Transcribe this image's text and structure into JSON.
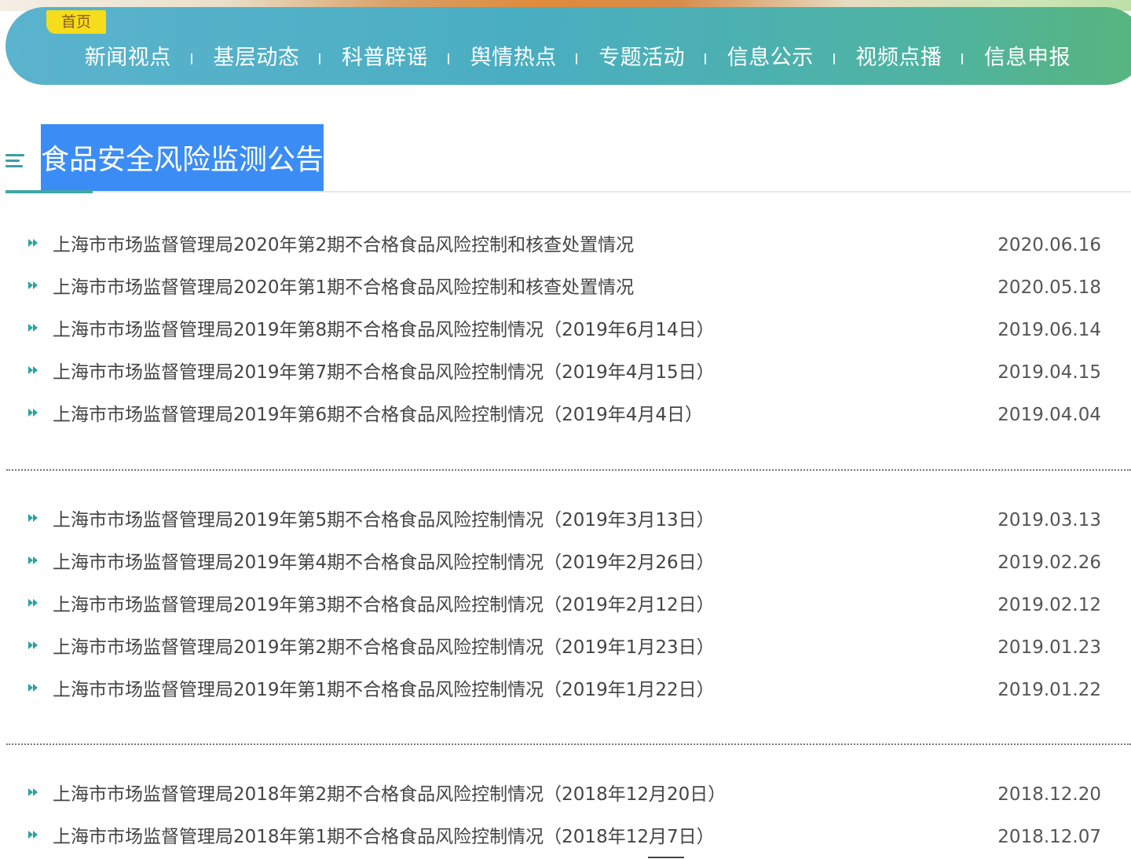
{
  "nav": {
    "home_tab": "首页",
    "items": [
      "新闻视点",
      "基层动态",
      "科普辟谣",
      "舆情热点",
      "专题活动",
      "信息公示",
      "视频点播",
      "信息申报"
    ]
  },
  "section": {
    "title": "食品安全风险监测公告"
  },
  "groups": [
    {
      "items": [
        {
          "title": "上海市市场监督管理局2020年第2期不合格食品风险控制和核查处置情况",
          "date": "2020.06.16"
        },
        {
          "title": "上海市市场监督管理局2020年第1期不合格食品风险控制和核查处置情况",
          "date": "2020.05.18"
        },
        {
          "title": "上海市市场监督管理局2019年第8期不合格食品风险控制情况（2019年6月14日）",
          "date": "2019.06.14"
        },
        {
          "title": "上海市市场监督管理局2019年第7期不合格食品风险控制情况（2019年4月15日）",
          "date": "2019.04.15"
        },
        {
          "title": "上海市市场监督管理局2019年第6期不合格食品风险控制情况（2019年4月4日）",
          "date": "2019.04.04"
        }
      ]
    },
    {
      "items": [
        {
          "title": "上海市市场监督管理局2019年第5期不合格食品风险控制情况（2019年3月13日）",
          "date": "2019.03.13"
        },
        {
          "title": "上海市市场监督管理局2019年第4期不合格食品风险控制情况（2019年2月26日）",
          "date": "2019.02.26"
        },
        {
          "title": "上海市市场监督管理局2019年第3期不合格食品风险控制情况（2019年2月12日）",
          "date": "2019.02.12"
        },
        {
          "title": "上海市市场监督管理局2019年第2期不合格食品风险控制情况（2019年1月23日）",
          "date": "2019.01.23"
        },
        {
          "title": "上海市市场监督管理局2019年第1期不合格食品风险控制情况（2019年1月22日）",
          "date": "2019.01.22"
        }
      ]
    },
    {
      "items": [
        {
          "title": "上海市市场监督管理局2018年第2期不合格食品风险控制情况（2018年12月20日）",
          "date": "2018.12.20"
        },
        {
          "title": "上海市市场监督管理局2018年第1期不合格食品风险控制情况（2018年12月7日）",
          "date": "2018.12.07"
        }
      ]
    }
  ],
  "colors": {
    "accent": "#3b8df5",
    "bullet": "#2aa39f",
    "nav_start": "#5bb3cd",
    "nav_end": "#57b57d",
    "home_tab": "#f5dd1c"
  }
}
